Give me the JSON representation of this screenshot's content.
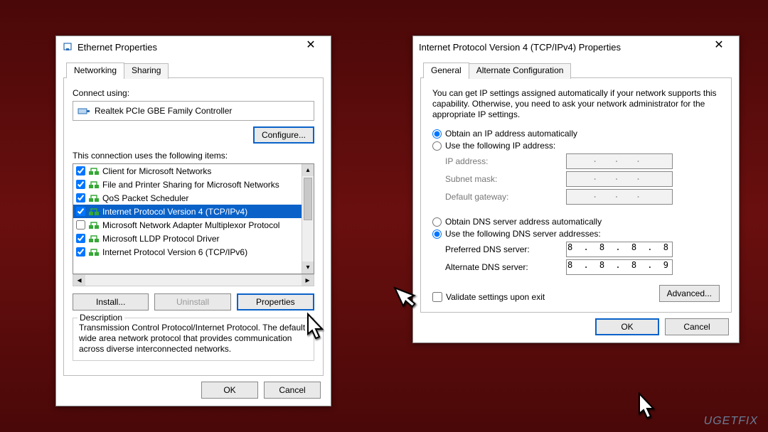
{
  "watermark": "UGETFIX",
  "left": {
    "title": "Ethernet Properties",
    "tabs": [
      "Networking",
      "Sharing"
    ],
    "connect_using_label": "Connect using:",
    "adapter": "Realtek PCIe GBE Family Controller",
    "configure_btn": "Configure...",
    "items_label": "This connection uses the following items:",
    "items": [
      {
        "checked": true,
        "label": "Client for Microsoft Networks"
      },
      {
        "checked": true,
        "label": "File and Printer Sharing for Microsoft Networks"
      },
      {
        "checked": true,
        "label": "QoS Packet Scheduler"
      },
      {
        "checked": true,
        "label": "Internet Protocol Version 4 (TCP/IPv4)",
        "selected": true
      },
      {
        "checked": false,
        "label": "Microsoft Network Adapter Multiplexor Protocol"
      },
      {
        "checked": true,
        "label": "Microsoft LLDP Protocol Driver"
      },
      {
        "checked": true,
        "label": "Internet Protocol Version 6 (TCP/IPv6)"
      }
    ],
    "install_btn": "Install...",
    "uninstall_btn": "Uninstall",
    "properties_btn": "Properties",
    "description_legend": "Description",
    "description_text": "Transmission Control Protocol/Internet Protocol. The default wide area network protocol that provides communication across diverse interconnected networks.",
    "ok_btn": "OK",
    "cancel_btn": "Cancel"
  },
  "right": {
    "title": "Internet Protocol Version 4 (TCP/IPv4) Properties",
    "tabs": [
      "General",
      "Alternate Configuration"
    ],
    "intro": "You can get IP settings assigned automatically if your network supports this capability. Otherwise, you need to ask your network administrator for the appropriate IP settings.",
    "ip_auto": "Obtain an IP address automatically",
    "ip_manual": "Use the following IP address:",
    "ip_fields": {
      "ip_label": "IP address:",
      "subnet_label": "Subnet mask:",
      "gateway_label": "Default gateway:",
      "dots": ".   .   ."
    },
    "dns_auto": "Obtain DNS server address automatically",
    "dns_manual": "Use the following DNS server addresses:",
    "preferred_label": "Preferred DNS server:",
    "alternate_label": "Alternate DNS server:",
    "preferred_value": "8 . 8 . 8 . 8",
    "alternate_value": "8 . 8 . 8 . 9",
    "validate_label": "Validate settings upon exit",
    "advanced_btn": "Advanced...",
    "ok_btn": "OK",
    "cancel_btn": "Cancel"
  }
}
